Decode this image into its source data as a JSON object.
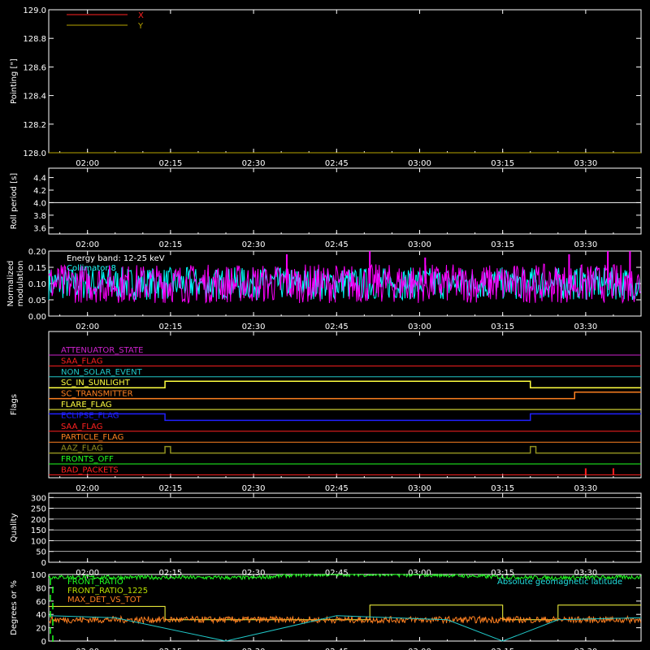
{
  "time_ticks": [
    "02:00",
    "02:15",
    "02:30",
    "02:45",
    "03:00",
    "03:15",
    "03:30"
  ],
  "chart_data": [
    {
      "type": "line",
      "ylabel": "Pointing [\"]",
      "yticks": [
        "128.0",
        "128.2",
        "128.4",
        "128.6",
        "128.8",
        "129.0"
      ],
      "ylim": [
        128.0,
        129.0
      ],
      "legend": [
        {
          "name": "X",
          "color": "#ff2020"
        },
        {
          "name": "Y",
          "color": "#b8a400"
        }
      ],
      "series": [
        {
          "name": "X",
          "color": "#ff2020",
          "x": [
            "01:53",
            "03:40"
          ],
          "y": [
            128.0,
            128.0
          ]
        },
        {
          "name": "Y",
          "color": "#b8a400",
          "x": [
            "01:53",
            "03:40"
          ],
          "y": [
            128.0,
            128.0
          ]
        }
      ]
    },
    {
      "type": "line",
      "ylabel": "Roll period [s]",
      "yticks": [
        "3.6",
        "3.8",
        "4.0",
        "4.2",
        "4.4"
      ],
      "ylim": [
        3.5,
        4.55
      ],
      "series": [
        {
          "color": "#ffffff",
          "x": [
            "01:53",
            "03:40"
          ],
          "y": [
            4.0,
            4.0
          ]
        }
      ]
    },
    {
      "type": "line",
      "ylabel": "Normalized modulation",
      "yticks": [
        "0.00",
        "0.05",
        "0.10",
        "0.15",
        "0.20"
      ],
      "ylim": [
        0.0,
        0.2
      ],
      "annotations": [
        "Energy band: 12-25 keV",
        "Collimator 8"
      ],
      "series": [
        {
          "color": "#00ffff",
          "x": [
            "01:53",
            "03:40"
          ],
          "y": [
            0.1,
            0.1
          ],
          "noise": 0.05
        },
        {
          "color": "#ff00ff",
          "x": [
            "01:53",
            "03:40"
          ],
          "y": [
            0.1,
            0.1
          ],
          "noise": 0.06
        }
      ],
      "spikes": [
        {
          "x": "02:36",
          "y": 0.19
        },
        {
          "x": "02:51",
          "y": 0.2
        },
        {
          "x": "03:01",
          "y": 0.18
        },
        {
          "x": "03:27",
          "y": 0.19
        },
        {
          "x": "03:34",
          "y": 0.2
        },
        {
          "x": "03:38",
          "y": 0.2
        }
      ]
    },
    {
      "type": "line",
      "ylabel": "Flags",
      "flags": [
        {
          "name": "ATTENUATOR_STATE",
          "color": "#cc22cc",
          "steps": []
        },
        {
          "name": "SAA_FLAG",
          "color": "#ff2020",
          "steps": []
        },
        {
          "name": "NON_SOLAR_EVENT",
          "color": "#20c8c8",
          "steps": []
        },
        {
          "name": "SC_IN_SUNLIGHT",
          "color": "#ffff40",
          "steps": [
            [
              "01:53",
              0
            ],
            [
              "02:14",
              1
            ],
            [
              "03:20",
              0
            ]
          ]
        },
        {
          "name": "SC_TRANSMITTER",
          "color": "#ff8020",
          "steps": [
            [
              "01:53",
              0
            ],
            [
              "03:28",
              1
            ]
          ]
        },
        {
          "name": "FLARE_FLAG",
          "color": "#ffff40",
          "steps": []
        },
        {
          "name": "ECLIPSE_FLAG",
          "color": "#2020ff",
          "steps": [
            [
              "01:53",
              1
            ],
            [
              "02:14",
              0
            ],
            [
              "03:20",
              1
            ]
          ]
        },
        {
          "name": "SAA_FLAG",
          "color": "#ff2020",
          "steps": []
        },
        {
          "name": "PARTICLE_FLAG",
          "color": "#ff8020",
          "steps": []
        },
        {
          "name": "AAZ_FLAG",
          "color": "#909020",
          "steps": [
            [
              "01:53",
              0
            ],
            [
              "02:14",
              1
            ],
            [
              "02:15",
              0
            ],
            [
              "03:20",
              1
            ],
            [
              "03:21",
              0
            ]
          ]
        },
        {
          "name": "FRONTS_OFF",
          "color": "#20ff20",
          "steps": []
        },
        {
          "name": "BAD_PACKETS",
          "color": "#ff2020",
          "steps": [],
          "ticks": [
            "03:30",
            "03:35"
          ]
        }
      ]
    },
    {
      "type": "line",
      "ylabel": "Quality",
      "yticks": [
        "0",
        "50",
        "100",
        "150",
        "200",
        "250",
        "300"
      ],
      "ylim": [
        0,
        320
      ],
      "series": []
    },
    {
      "type": "line",
      "ylabel": "Degrees or %",
      "yticks": [
        "0",
        "20",
        "40",
        "60",
        "80",
        "100"
      ],
      "ylim": [
        0,
        100
      ],
      "legend": [
        {
          "name": "FRONT_RATIO",
          "color": "#20ff20"
        },
        {
          "name": "FRONT_RATIO_1225",
          "color": "#b8e000"
        },
        {
          "name": "MAX_DET_VS_TOT",
          "color": "#ff8020"
        }
      ],
      "annotation": "Absolute geomagnetic latitude",
      "series": [
        {
          "name": "FRONT_RATIO",
          "color": "#20ff20",
          "x": [
            "01:53",
            "02:30",
            "02:37",
            "02:45",
            "03:05",
            "03:15",
            "03:25",
            "03:40"
          ],
          "y": [
            96,
            95,
            99,
            100,
            99,
            96,
            95,
            96
          ],
          "noise": 3
        },
        {
          "name": "FRONT_RATIO_1225",
          "color": "#ffff40",
          "x": [
            "01:53",
            "02:14",
            "02:14",
            "02:30",
            "02:30",
            "02:51",
            "02:51",
            "03:15",
            "03:15",
            "03:25",
            "03:25",
            "03:40"
          ],
          "y": [
            52,
            52,
            32,
            32,
            32,
            32,
            54,
            54,
            32,
            32,
            54,
            54
          ]
        },
        {
          "name": "MAX_DET_VS_TOT",
          "color": "#ff8020",
          "x": [
            "01:53",
            "03:40"
          ],
          "y": [
            32,
            32
          ],
          "noise": 5
        },
        {
          "name": "Absolute geomagnetic latitude",
          "color": "#20c8c8",
          "x": [
            "01:53",
            "02:05",
            "02:25",
            "02:45",
            "03:05",
            "03:15",
            "03:25",
            "03:40"
          ],
          "y": [
            38,
            35,
            0,
            38,
            32,
            0,
            32,
            35
          ]
        }
      ]
    }
  ]
}
